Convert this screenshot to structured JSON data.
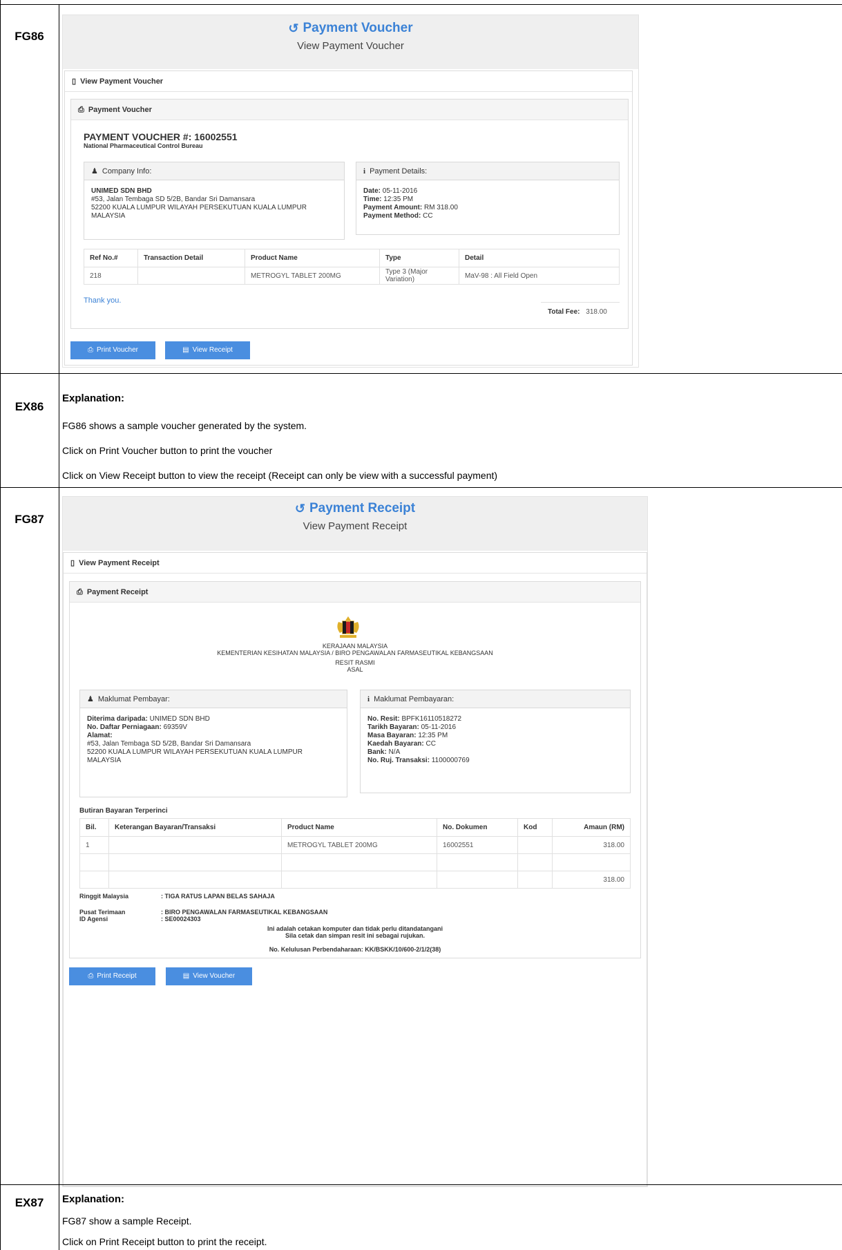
{
  "rows": {
    "fg86": "FG86",
    "ex86": "EX86",
    "fg87": "FG87",
    "ex87": "EX87"
  },
  "voucher": {
    "title": "Payment Voucher",
    "subtitle": "View Payment Voucher",
    "section_label": "View Payment Voucher",
    "panel_label": "Payment Voucher",
    "heading": "PAYMENT VOUCHER #: 16002551",
    "org": "National Pharmaceutical Control Bureau",
    "company_box": {
      "label": "Company Info:",
      "name": "UNIMED SDN BHD",
      "addr1": "#53, Jalan Tembaga SD 5/2B, Bandar Sri Damansara",
      "addr2": "52200 KUALA LUMPUR WILAYAH PERSEKUTUAN KUALA LUMPUR",
      "addr3": "MALAYSIA"
    },
    "payment_box": {
      "label": "Payment Details:",
      "date_label": "Date:",
      "date": " 05-11-2016",
      "time_label": "Time:",
      "time": " 12:35 PM",
      "amount_label": "Payment Amount:",
      "amount": " RM 318.00",
      "method_label": "Payment Method:",
      "method": " CC"
    },
    "table": {
      "headers": [
        "Ref No.#",
        "Transaction Detail",
        "Product Name",
        "Type",
        "Detail"
      ],
      "row": [
        "218",
        "",
        "METROGYL TABLET 200MG",
        "Type 3 (Major Variation)",
        "MaV-98 : All Field Open"
      ]
    },
    "thanks": "Thank you.",
    "total_label": "Total Fee:",
    "total_value": "318.00",
    "print_button": "Print Voucher",
    "receipt_button": "View Receipt"
  },
  "explanation86": {
    "heading": "Explanation:",
    "line1": "FG86 shows a sample voucher generated by the system.",
    "line2": "Click on Print Voucher button to print the voucher",
    "line3": "Click on View Receipt button to view the receipt (Receipt can only be view with a successful payment)"
  },
  "receipt": {
    "title": "Payment Receipt",
    "subtitle": "View Payment Receipt",
    "section_label": "View Payment Receipt",
    "panel_label": "Payment Receipt",
    "gov1": "KERAJAAN MALAYSIA",
    "gov2": "KEMENTERIAN KESIHATAN MALAYSIA / BIRO PENGAWALAN FARMASEUTIKAL KEBANGSAAN",
    "gov3": "RESIT RASMI",
    "gov4": "ASAL",
    "payer_box": {
      "label": "Maklumat Pembayar:",
      "received_label": "Diterima daripada:",
      "received": " UNIMED SDN BHD",
      "reg_label": "No. Daftar Perniagaan:",
      "reg": " 69359V",
      "addr_label": "Alamat:",
      "addr1": "#53, Jalan Tembaga SD 5/2B, Bandar Sri Damansara",
      "addr2": "52200 KUALA LUMPUR WILAYAH PERSEKUTUAN KUALA LUMPUR",
      "addr3": "MALAYSIA"
    },
    "pay_box": {
      "label": "Maklumat Pembayaran:",
      "resit_label": "No. Resit:",
      "resit": " BPFK16110518272",
      "tarikh_label": "Tarikh Bayaran:",
      "tarikh": " 05-11-2016",
      "masa_label": "Masa Bayaran:",
      "masa": " 12:35 PM",
      "kaedah_label": "Kaedah Bayaran:",
      "kaedah": " CC",
      "bank_label": "Bank:",
      "bank": " N/A",
      "ruj_label": "No. Ruj. Transaksi:",
      "ruj": " 1100000769"
    },
    "details_title": "Butiran Bayaran Terperinci",
    "table": {
      "headers": [
        "Bil.",
        "Keterangan Bayaran/Transaksi",
        "Product Name",
        "No. Dokumen",
        "Kod",
        "Amaun (RM)"
      ],
      "row1": [
        "1",
        "",
        "METROGYL TABLET 200MG",
        "16002551",
        "",
        "318.00"
      ],
      "total": "318.00"
    },
    "ringgit_label": "Ringgit Malaysia",
    "ringgit_value": ": TIGA RATUS LAPAN BELAS SAHAJA",
    "pusat_label": "Pusat Terimaan",
    "pusat_value": ": BIRO PENGAWALAN FARMASEUTIKAL KEBANGSAAN",
    "agensi_label": "ID Agensi",
    "agensi_value": ": SE00024303",
    "note1": "Ini adalah cetakan komputer dan tidak perlu ditandatangani",
    "note2": "Sila cetak dan simpan resit ini sebagai rujukan.",
    "approval": "No. Kelulusan Perbendaharaan: KK/BSKK/10/600-2/1/2(38)",
    "print_button": "Print Receipt",
    "voucher_button": "View Voucher"
  },
  "explanation87": {
    "heading": "Explanation:",
    "line1": "FG87 show a sample Receipt.",
    "line2": "Click on Print Receipt button to print the receipt."
  }
}
